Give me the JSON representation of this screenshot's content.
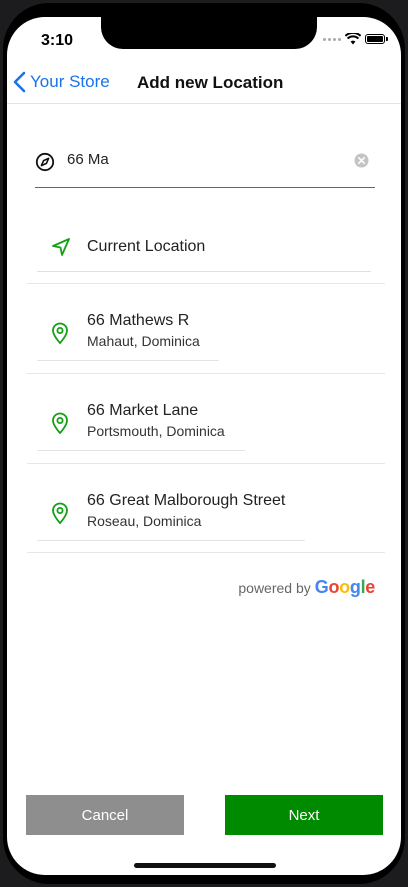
{
  "status_bar": {
    "time": "3:10"
  },
  "nav": {
    "back_label": "Your Store",
    "title": "Add new Location"
  },
  "search": {
    "value": "66 Ma",
    "placeholder": ""
  },
  "current_location": {
    "label": "Current Location"
  },
  "results": [
    {
      "title": "66 Mathews R",
      "subtitle": "Mahaut, Dominica"
    },
    {
      "title": "66 Market Lane",
      "subtitle": "Portsmouth, Dominica"
    },
    {
      "title": "66 Great Malborough Street",
      "subtitle": "Roseau, Dominica"
    }
  ],
  "attribution": {
    "prefix": "powered by",
    "brand_letters": [
      "G",
      "o",
      "o",
      "g",
      "l",
      "e"
    ]
  },
  "buttons": {
    "cancel_label": "Cancel",
    "next_label": "Next"
  },
  "colors": {
    "accent_blue": "#1a73e8",
    "pin_green": "#14a014",
    "next_green": "#008a00",
    "cancel_gray": "#8e8e8e",
    "google": [
      "#4285F4",
      "#EA4335",
      "#FBBC05",
      "#4285F4",
      "#34A853",
      "#EA4335"
    ]
  },
  "icons": {
    "back": "chevron-left-icon",
    "compass": "compass-icon",
    "clear": "clear-icon",
    "current_location": "navigation-arrow-icon",
    "result": "map-pin-icon"
  }
}
